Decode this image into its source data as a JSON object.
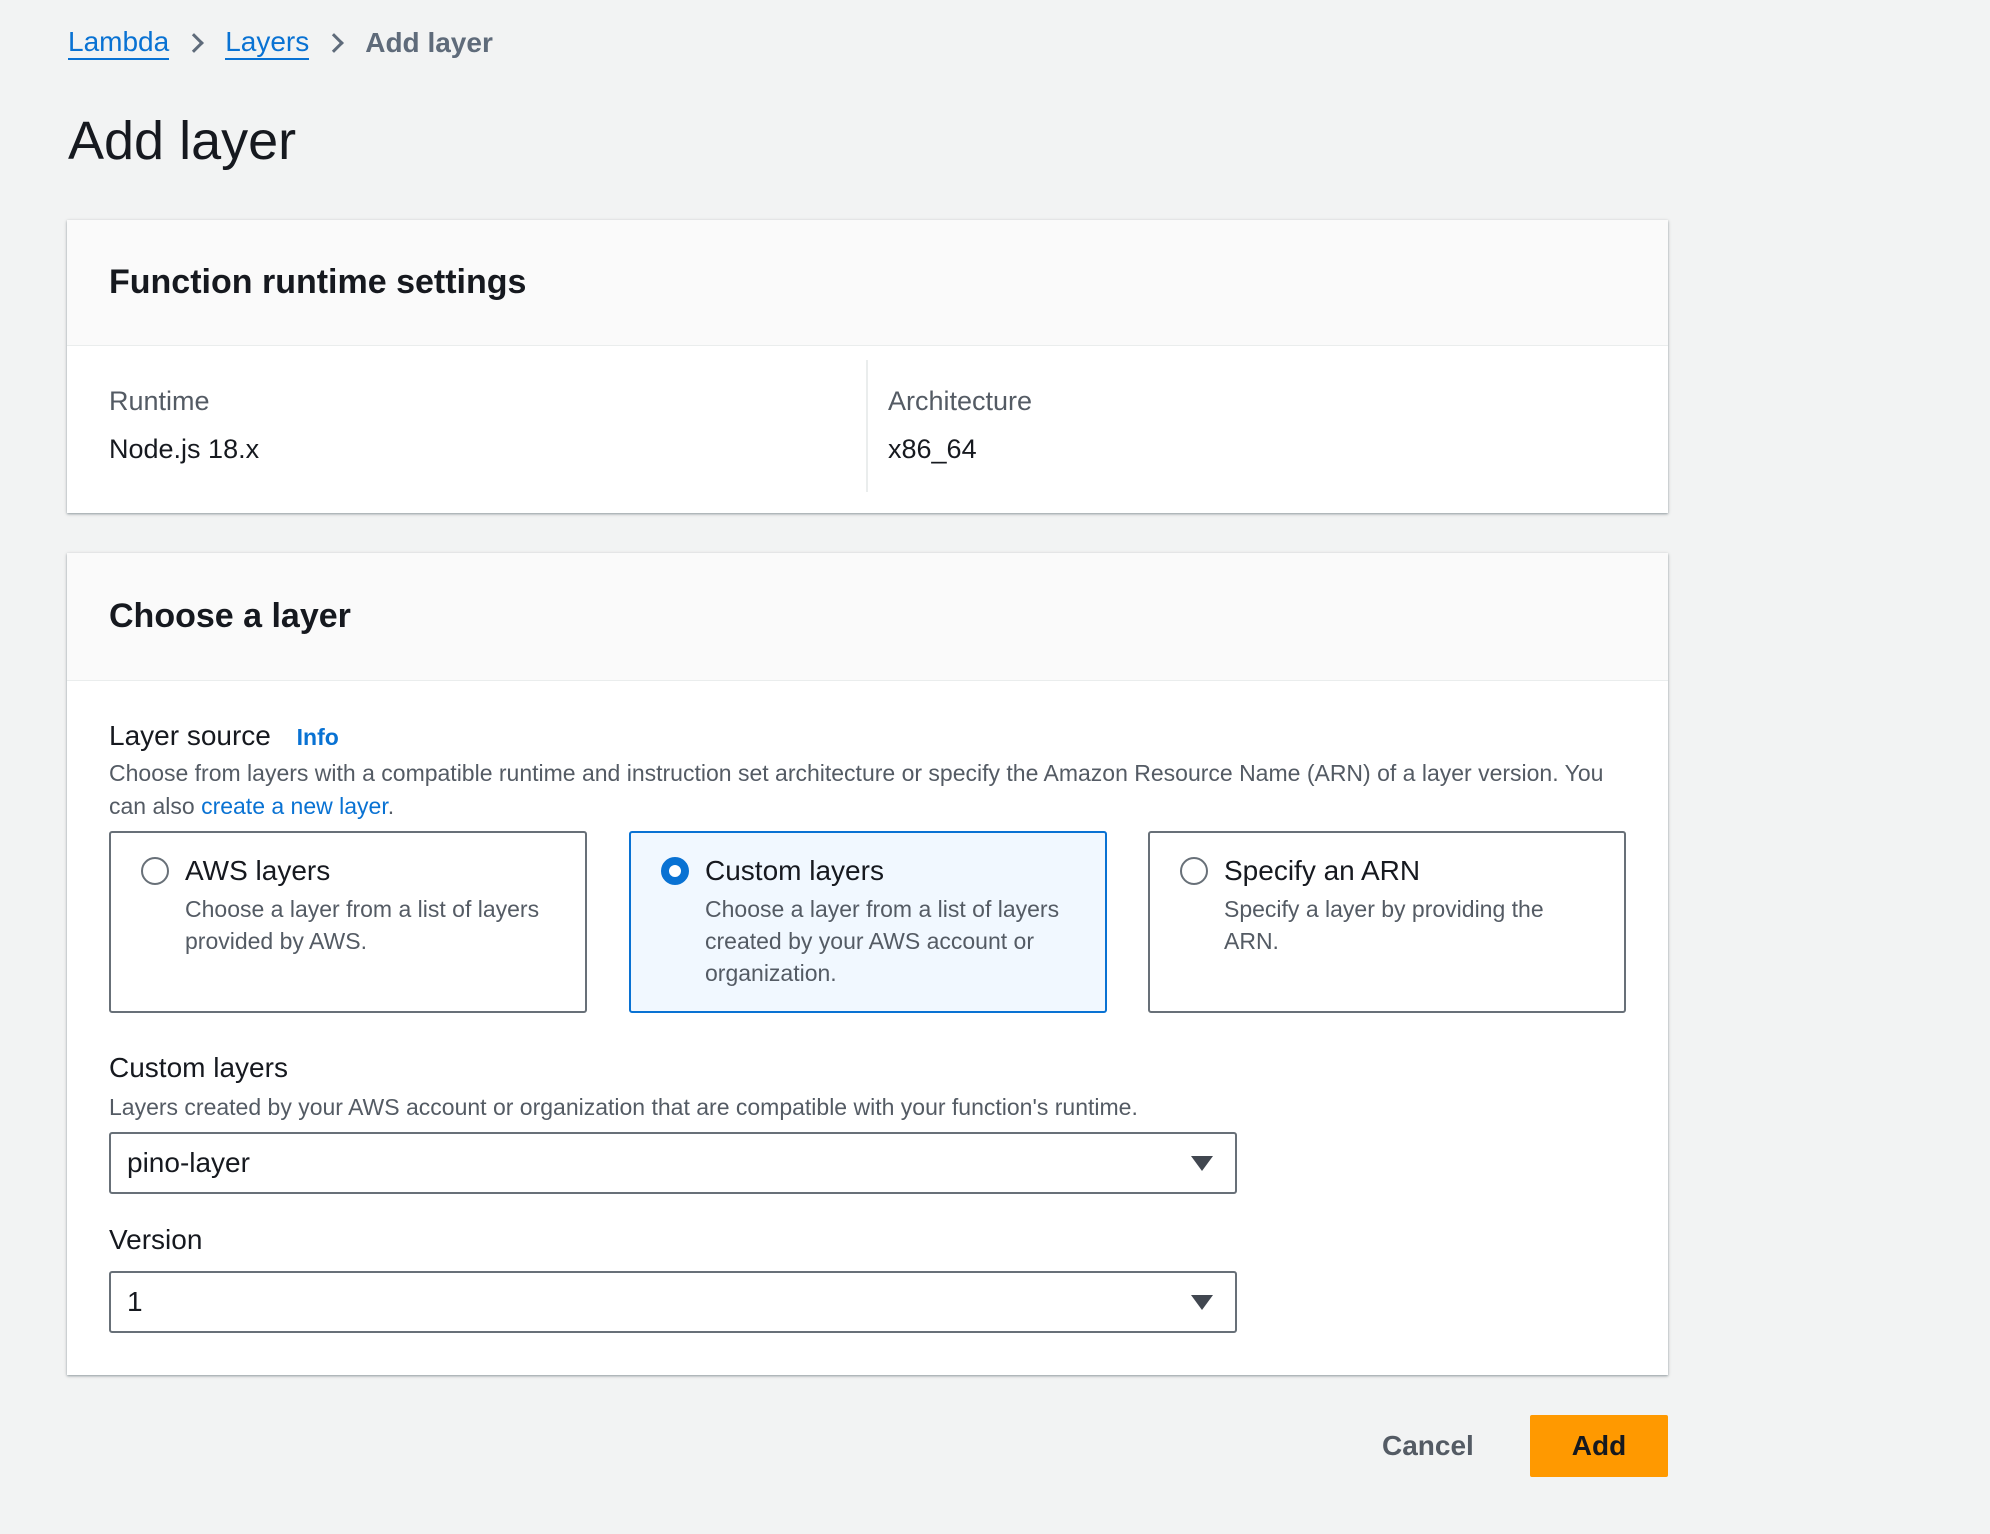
{
  "breadcrumb": {
    "items": [
      "Lambda",
      "Layers"
    ],
    "current": "Add layer"
  },
  "page_title": "Add layer",
  "runtime_card": {
    "title": "Function runtime settings",
    "runtime_label": "Runtime",
    "runtime_value": "Node.js 18.x",
    "arch_label": "Architecture",
    "arch_value": "x86_64"
  },
  "layer_card": {
    "title": "Choose a layer",
    "source_label": "Layer source",
    "info": "Info",
    "source_desc": "Choose from layers with a compatible runtime and instruction set architecture or specify the Amazon Resource Name (ARN) of a layer version. You can also ",
    "create_link": "create a new layer",
    "period": ".",
    "options": [
      {
        "title": "AWS layers",
        "desc": "Choose a layer from a list of layers provided by AWS.",
        "selected": false
      },
      {
        "title": "Custom layers",
        "desc": "Choose a layer from a list of layers created by your AWS account or organization.",
        "selected": true
      },
      {
        "title": "Specify an ARN",
        "desc": "Specify a layer by providing the ARN.",
        "selected": false
      }
    ],
    "custom_label": "Custom layers",
    "custom_desc": "Layers created by your AWS account or organization that are compatible with your function's runtime.",
    "custom_value": "pino-layer",
    "version_label": "Version",
    "version_value": "1"
  },
  "actions": {
    "cancel": "Cancel",
    "add": "Add"
  },
  "colors": {
    "accent": "#0972d3",
    "primary_button": "#ff9900"
  }
}
